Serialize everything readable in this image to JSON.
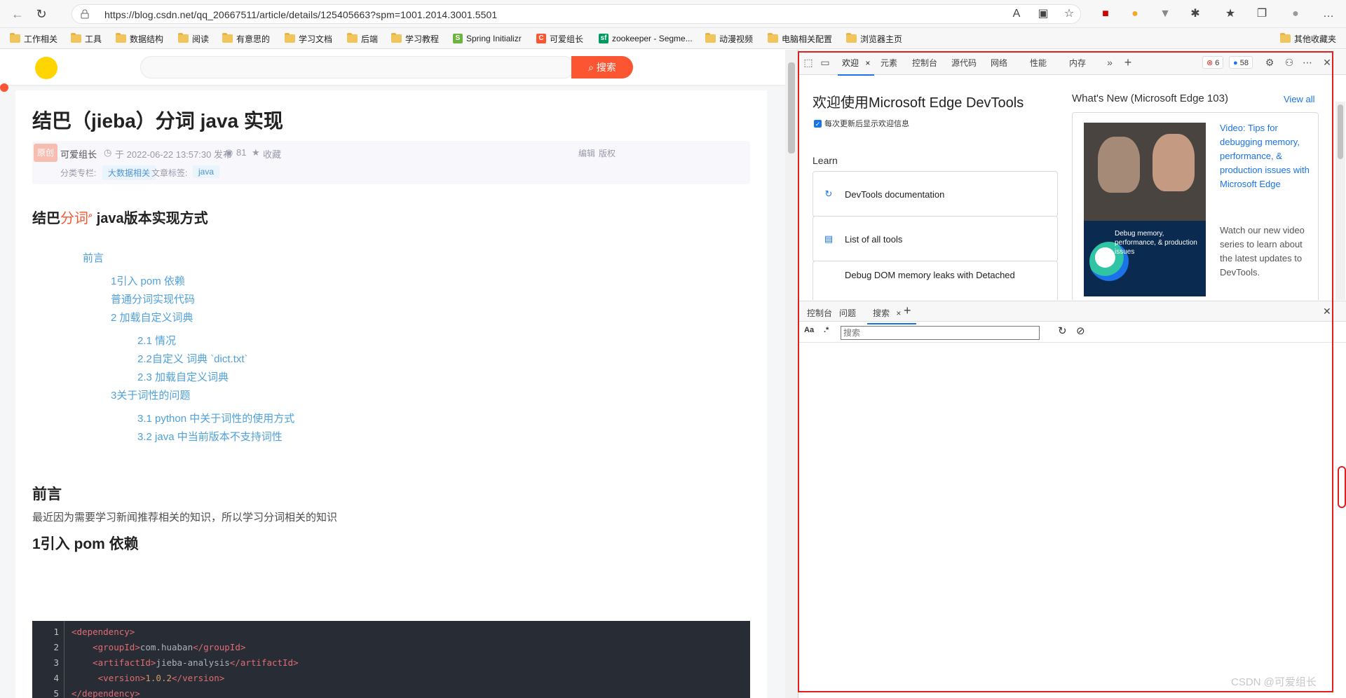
{
  "browser": {
    "url": "https://blog.csdn.net/qq_20667511/article/details/125405663?spm=1001.2014.3001.5501",
    "bookmarks": [
      "工作相关",
      "工具",
      "数据结构",
      "阅读",
      "有意思的",
      "学习文档",
      "后端",
      "学习教程",
      "Spring Initializr",
      "可爱组长",
      "zookeeper - Segme...",
      "动漫视频",
      "电脑相关配置",
      "浏览器主页"
    ],
    "other_bookmarks": "其他收藏夹"
  },
  "csdn": {
    "search_button": "搜索"
  },
  "article": {
    "title": "结巴（jieba）分词 java 实现",
    "badge": "原创",
    "author": "可爱组长",
    "date": "于 2022-06-22 13:57:30 发布",
    "views": "81",
    "favorite": "收藏",
    "edit": "编辑",
    "copyright": "版权",
    "column_label": "分类专栏:",
    "column_tag": "大数据相关",
    "tags_label": "文章标签:",
    "tag": "java",
    "heading_pre": "结巴",
    "heading_red": "分词",
    "heading_post": "java版本实现方式",
    "toc": [
      "前言",
      "1引入 pom 依赖",
      "普通分词实现代码",
      "2 加载自定义词典",
      "2.1 情况",
      "2.2自定义 词典 `dict.txt`",
      "2.3 加载自定义词典",
      "3关于词性的问题",
      "3.1 python 中关于词性的使用方式",
      "3.2 java 中当前版本不支持词性"
    ],
    "section1": "前言",
    "section1_text": "最近因为需要学习新闻推荐相关的知识，所以学习分词相关的知识",
    "section2": "1引入 pom 依赖",
    "code_lines": [
      {
        "n": "1",
        "indent": "",
        "tag": "dependency",
        "text": "",
        "close": ""
      },
      {
        "n": "2",
        "indent": "    ",
        "tag": "groupId",
        "text": "com.huaban",
        "close": "groupId"
      },
      {
        "n": "3",
        "indent": "    ",
        "tag": "artifactId",
        "text": "jieba-analysis",
        "close": "artifactId"
      },
      {
        "n": "4",
        "indent": "     ",
        "tag": "version",
        "text": "1.0.2",
        "close": "version"
      },
      {
        "n": "5",
        "indent": "",
        "tag": "/dependency",
        "text": "",
        "close": ""
      }
    ]
  },
  "devtools": {
    "tabs": [
      "欢迎",
      "元素",
      "控制台",
      "源代码",
      "网络",
      "性能",
      "内存"
    ],
    "errors": "6",
    "messages": "58",
    "welcome_title": "欢迎使用Microsoft Edge DevTools",
    "show_welcome": "每次更新后显示欢迎信息",
    "learn": "Learn",
    "cards": [
      "DevTools documentation",
      "List of all tools",
      "Debug DOM memory leaks with Detached"
    ],
    "whats_new": "What's New (Microsoft Edge 103)",
    "view_all": "View all",
    "video_title": "Video: Tips for debugging memory, performance, & production issues with Microsoft Edge",
    "video_desc": "Watch our new video series to learn about the latest updates to DevTools.",
    "video_caption": "Debug memory, performance, & production issues",
    "drawer_tabs": [
      "控制台",
      "问题",
      "搜索"
    ],
    "search_placeholder": "搜索",
    "case_btn": "Aa",
    "regex_btn": ".*"
  },
  "watermark": "CSDN @可爱组长",
  "colors": {
    "accent": "#fc5531",
    "link": "#4ea1db",
    "devtools_blue": "#1a73e8",
    "highlight": "#e02020"
  }
}
